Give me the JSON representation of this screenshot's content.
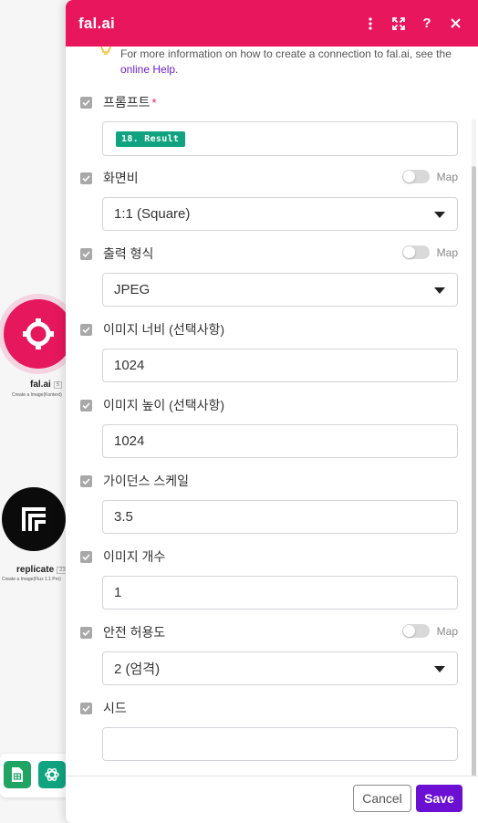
{
  "canvas": {
    "nodes": [
      {
        "name": "fal.ai",
        "badge": "5",
        "subtitle": "Create a Image(Kontext)"
      },
      {
        "name": "replicate",
        "badge": "23",
        "subtitle": "Create a Image(Flux 1.1 Pro)"
      }
    ]
  },
  "modal": {
    "title": "fal.ai",
    "info": {
      "text_before": "For more information on how to create a connection to fal.ai, see the ",
      "link": "online Help",
      "text_after": "."
    },
    "map_label": "Map",
    "fields": {
      "prompt": {
        "label": "프롬프트",
        "required_mark": "*",
        "pill": "18. Result"
      },
      "aspect": {
        "label": "화면비",
        "value": "1:1 (Square)"
      },
      "format": {
        "label": "출력 형식",
        "value": "JPEG"
      },
      "width": {
        "label": "이미지 너비 (선택사항)",
        "value": "1024"
      },
      "height": {
        "label": "이미지 높이 (선택사항)",
        "value": "1024"
      },
      "guidance": {
        "label": "가이던스 스케일",
        "value": "3.5"
      },
      "count": {
        "label": "이미지 개수",
        "value": "1"
      },
      "safety": {
        "label": "안전 허용도",
        "value": "2 (엄격)"
      },
      "seed": {
        "label": "시드",
        "value": ""
      }
    },
    "footer": {
      "cancel": "Cancel",
      "save": "Save"
    }
  },
  "colors": {
    "brand": "#e8175d",
    "save": "#6b10d3",
    "pill": "#10a37f"
  }
}
